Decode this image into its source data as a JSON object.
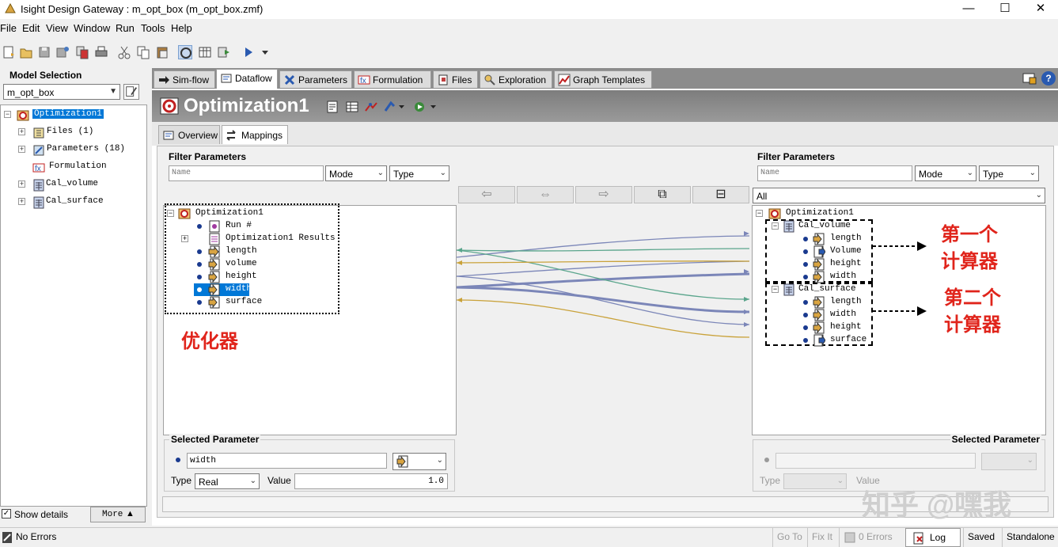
{
  "window": {
    "title": "Isight Design Gateway : m_opt_box (m_opt_box.zmf)",
    "minimize": "—",
    "maximize": "☐",
    "close": "✕"
  },
  "menu": [
    "File",
    "Edit",
    "View",
    "Window",
    "Run",
    "Tools",
    "Help"
  ],
  "toolbar_icons": [
    "new-icon",
    "open-icon",
    "save-icon",
    "save-as-icon",
    "copy-model-icon",
    "print-icon",
    "cut-icon",
    "copy-icon",
    "paste-icon",
    "link-icon",
    "table-icon",
    "export-icon",
    "run-icon",
    "run-dropdown-icon"
  ],
  "left": {
    "header": "Model Selection",
    "model_combo": "m_opt_box",
    "tree": [
      {
        "label": "Optimization1",
        "selected": true,
        "icon": "optimization-icon"
      },
      {
        "label": "Files (1)",
        "icon": "files-icon"
      },
      {
        "label": "Parameters (18)",
        "icon": "parameters-icon"
      },
      {
        "label": "Formulation",
        "icon": "formulation-icon"
      },
      {
        "label": "Cal_volume",
        "icon": "calculator-icon"
      },
      {
        "label": "Cal_surface",
        "icon": "calculator-icon"
      }
    ],
    "show_details": "Show details",
    "more": "More"
  },
  "tabs": [
    "Sim-flow",
    "Dataflow",
    "Parameters",
    "Formulation",
    "Files",
    "Exploration",
    "Graph Templates"
  ],
  "component_title": "Optimization1",
  "subtabs": [
    "Overview",
    "Mappings"
  ],
  "filter": {
    "left_label": "Filter Parameters",
    "right_label": "Filter Parameters",
    "name_placeholder": "Name",
    "mode": "Mode",
    "type": "Type",
    "all": "All"
  },
  "left_tree": {
    "root": "Optimization1",
    "items": [
      "Run #",
      "Optimization1 Results",
      "length",
      "volume",
      "height",
      "width",
      "surface"
    ],
    "selected": "width"
  },
  "right_tree": {
    "root": "Optimization1",
    "groups": [
      {
        "name": "Cal_volume",
        "items": [
          "length",
          "Volume",
          "height",
          "width"
        ]
      },
      {
        "name": "Cal_surface",
        "items": [
          "length",
          "width",
          "height",
          "surface"
        ]
      }
    ]
  },
  "annotations": {
    "optimizer": "优化器",
    "calc1_a": "第一个",
    "calc1_b": "计算器",
    "calc2_a": "第二个",
    "calc2_b": "计算器",
    "watermark": "知乎 @嘿我"
  },
  "selected_param": {
    "left_label": "Selected Parameter",
    "right_label": "Selected Parameter",
    "name": "width",
    "type_label": "Type",
    "type_value": "Real",
    "value_label": "Value",
    "value": "1.0",
    "right_type_label": "Type",
    "right_value_label": "Value"
  },
  "status": {
    "message": "No Errors",
    "goto": "Go To",
    "fixit": "Fix It",
    "errors": "0 Errors",
    "log": "Log",
    "saved": "Saved",
    "mode": "Standalone"
  },
  "colors": {
    "mapping_blue": "#7b86b8",
    "mapping_gold": "#c9a23a",
    "mapping_green": "#5aa58c",
    "selection": "#0078d7",
    "annotation_red": "#e0241b"
  }
}
